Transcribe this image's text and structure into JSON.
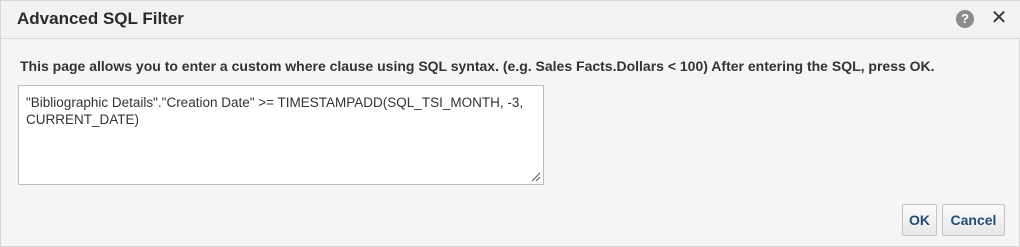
{
  "dialog": {
    "title": "Advanced SQL Filter",
    "help_icon": "help-icon",
    "help_glyph": "?",
    "close_icon": "close-icon",
    "close_glyph": "✕"
  },
  "instructions": "This page allows you to enter a custom where clause using SQL syntax. (e.g. Sales Facts.Dollars < 100) After entering the SQL, press OK.",
  "sql_input": {
    "value": "\"Bibliographic Details\".\"Creation Date\" >= TIMESTAMPADD(SQL_TSI_MONTH, -3, CURRENT_DATE)"
  },
  "buttons": {
    "ok_label": "OK",
    "cancel_label": "Cancel"
  },
  "colors": {
    "button_text": "#1f4e79",
    "background": "#f5f5f5",
    "help_icon_bg": "#8c8c8c"
  }
}
